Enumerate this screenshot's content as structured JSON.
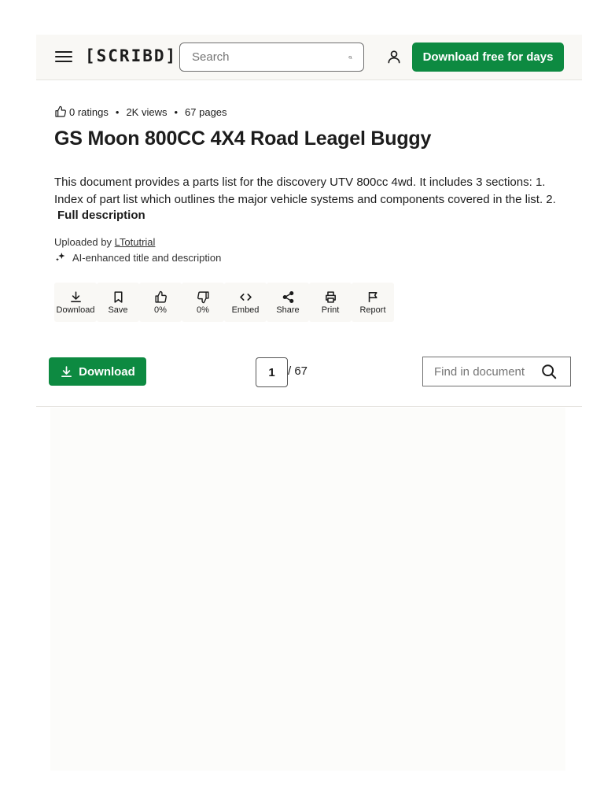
{
  "header": {
    "logo": "[SCRIBD]",
    "search_placeholder": "Search",
    "download_free_label": "Download free for days"
  },
  "meta": {
    "ratings": "0 ratings",
    "views": "2K views",
    "pages": "67 pages",
    "separator": "•"
  },
  "document": {
    "title": "GS Moon 800CC 4X4 Road Leagel Buggy",
    "description": "This document provides a parts list for the discovery UTV 800cc 4wd. It includes 3 sections: 1. Index of part list which outlines the major vehicle systems and components covered in the list. 2.",
    "full_description_label": "Full description",
    "uploaded_prefix": "Uploaded by",
    "uploader": "LTotutrial",
    "ai_note": "AI-enhanced title and description"
  },
  "actions": [
    {
      "label": "Download",
      "icon": "download-icon"
    },
    {
      "label": "Save",
      "icon": "bookmark-icon"
    },
    {
      "label": "0%",
      "icon": "thumbs-up-icon"
    },
    {
      "label": "0%",
      "icon": "thumbs-down-icon"
    },
    {
      "label": "Embed",
      "icon": "code-icon"
    },
    {
      "label": "Share",
      "icon": "share-icon"
    },
    {
      "label": "Print",
      "icon": "print-icon"
    },
    {
      "label": "Report",
      "icon": "flag-icon"
    }
  ],
  "toolbar": {
    "download_label": "Download",
    "current_page": "1",
    "total_pages": "/ 67",
    "find_placeholder": "Find in document"
  },
  "colors": {
    "brand_green": "#0d8a41",
    "header_bg": "#f9f8f5"
  }
}
